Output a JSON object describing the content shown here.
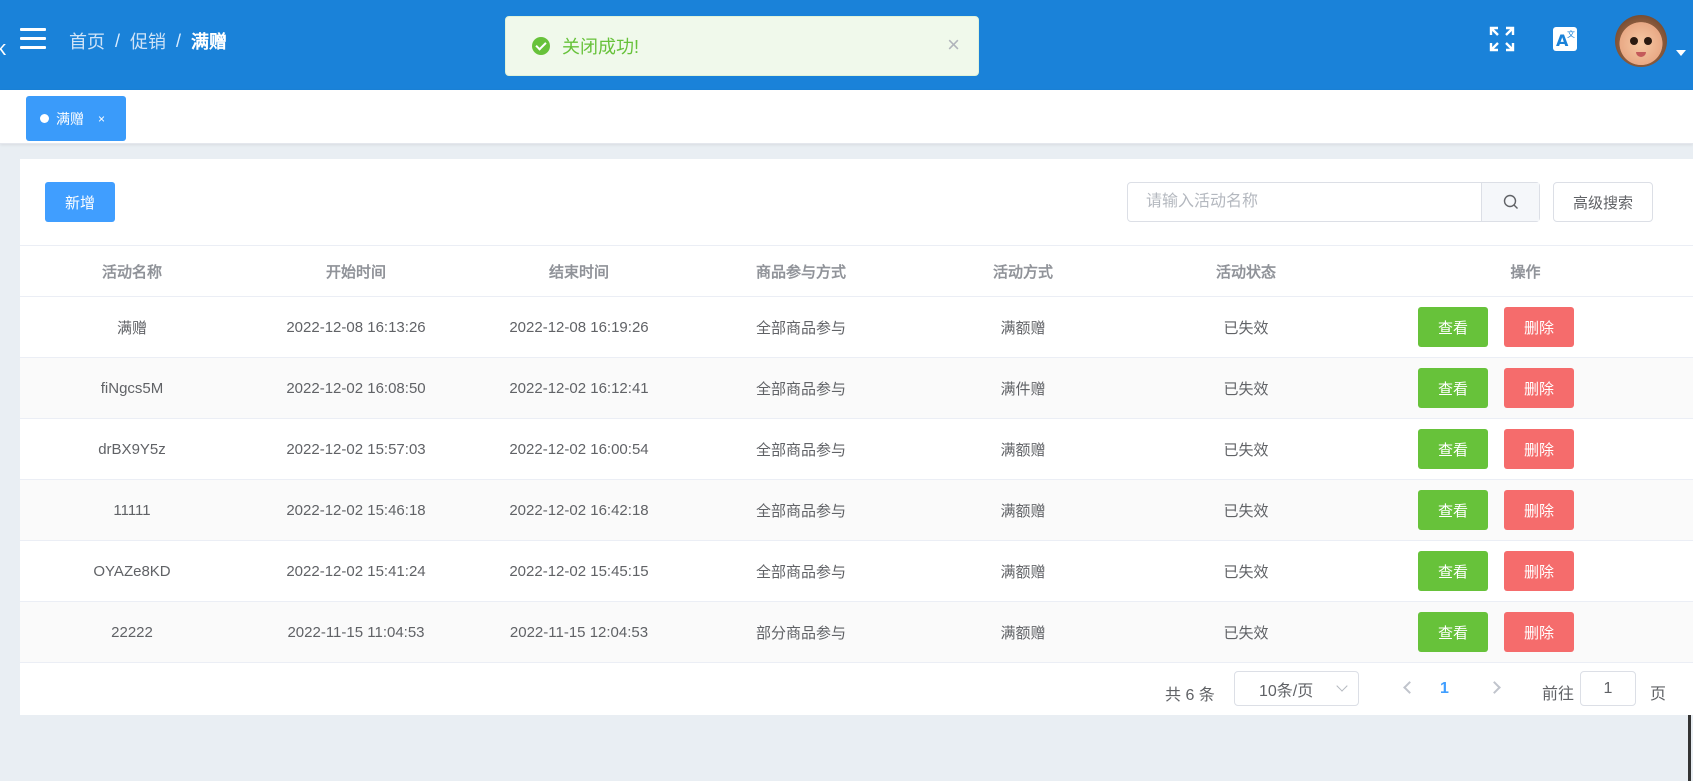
{
  "header": {
    "logo_fragment": "k",
    "breadcrumb": [
      "首页",
      "促销",
      "满赠"
    ],
    "breadcrumb_separator": "/",
    "icons": [
      "menu-icon",
      "fullscreen-icon",
      "translate-icon",
      "user-avatar"
    ]
  },
  "toast": {
    "message": "关闭成功!",
    "close_symbol": "×",
    "color": "#67c23a"
  },
  "tags": [
    {
      "label": "满赠",
      "close": "×",
      "active": true
    }
  ],
  "toolbar": {
    "add_label": "新增",
    "search_placeholder": "请输入活动名称",
    "advanced_search_label": "高级搜索"
  },
  "table": {
    "columns": [
      "活动名称",
      "开始时间",
      "结束时间",
      "商品参与方式",
      "活动方式",
      "活动状态",
      "操作"
    ],
    "rows": [
      {
        "name": "满赠",
        "start": "2022-12-08 16:13:26",
        "end": "2022-12-08 16:19:26",
        "mode": "全部商品参与",
        "type": "满额赠",
        "status": "已失效"
      },
      {
        "name": "fiNgcs5M",
        "start": "2022-12-02 16:08:50",
        "end": "2022-12-02 16:12:41",
        "mode": "全部商品参与",
        "type": "满件赠",
        "status": "已失效"
      },
      {
        "name": "drBX9Y5z",
        "start": "2022-12-02 15:57:03",
        "end": "2022-12-02 16:00:54",
        "mode": "全部商品参与",
        "type": "满额赠",
        "status": "已失效"
      },
      {
        "name": "11111",
        "start": "2022-12-02 15:46:18",
        "end": "2022-12-02 16:42:18",
        "mode": "全部商品参与",
        "type": "满额赠",
        "status": "已失效"
      },
      {
        "name": "OYAZe8KD",
        "start": "2022-12-02 15:41:24",
        "end": "2022-12-02 15:45:15",
        "mode": "全部商品参与",
        "type": "满额赠",
        "status": "已失效"
      },
      {
        "name": "22222",
        "start": "2022-11-15 11:04:53",
        "end": "2022-11-15 12:04:53",
        "mode": "部分商品参与",
        "type": "满额赠",
        "status": "已失效"
      }
    ],
    "view_label": "查看",
    "delete_label": "删除"
  },
  "pagination": {
    "total_text": "共 6 条",
    "page_size": "10条/页",
    "current_page": "1",
    "goto_label": "前往",
    "goto_value": "1",
    "page_suffix": "页"
  },
  "colors": {
    "header_bg": "#1a82d9",
    "primary": "#409eff",
    "success": "#67c23a",
    "danger": "#f56c6c"
  }
}
